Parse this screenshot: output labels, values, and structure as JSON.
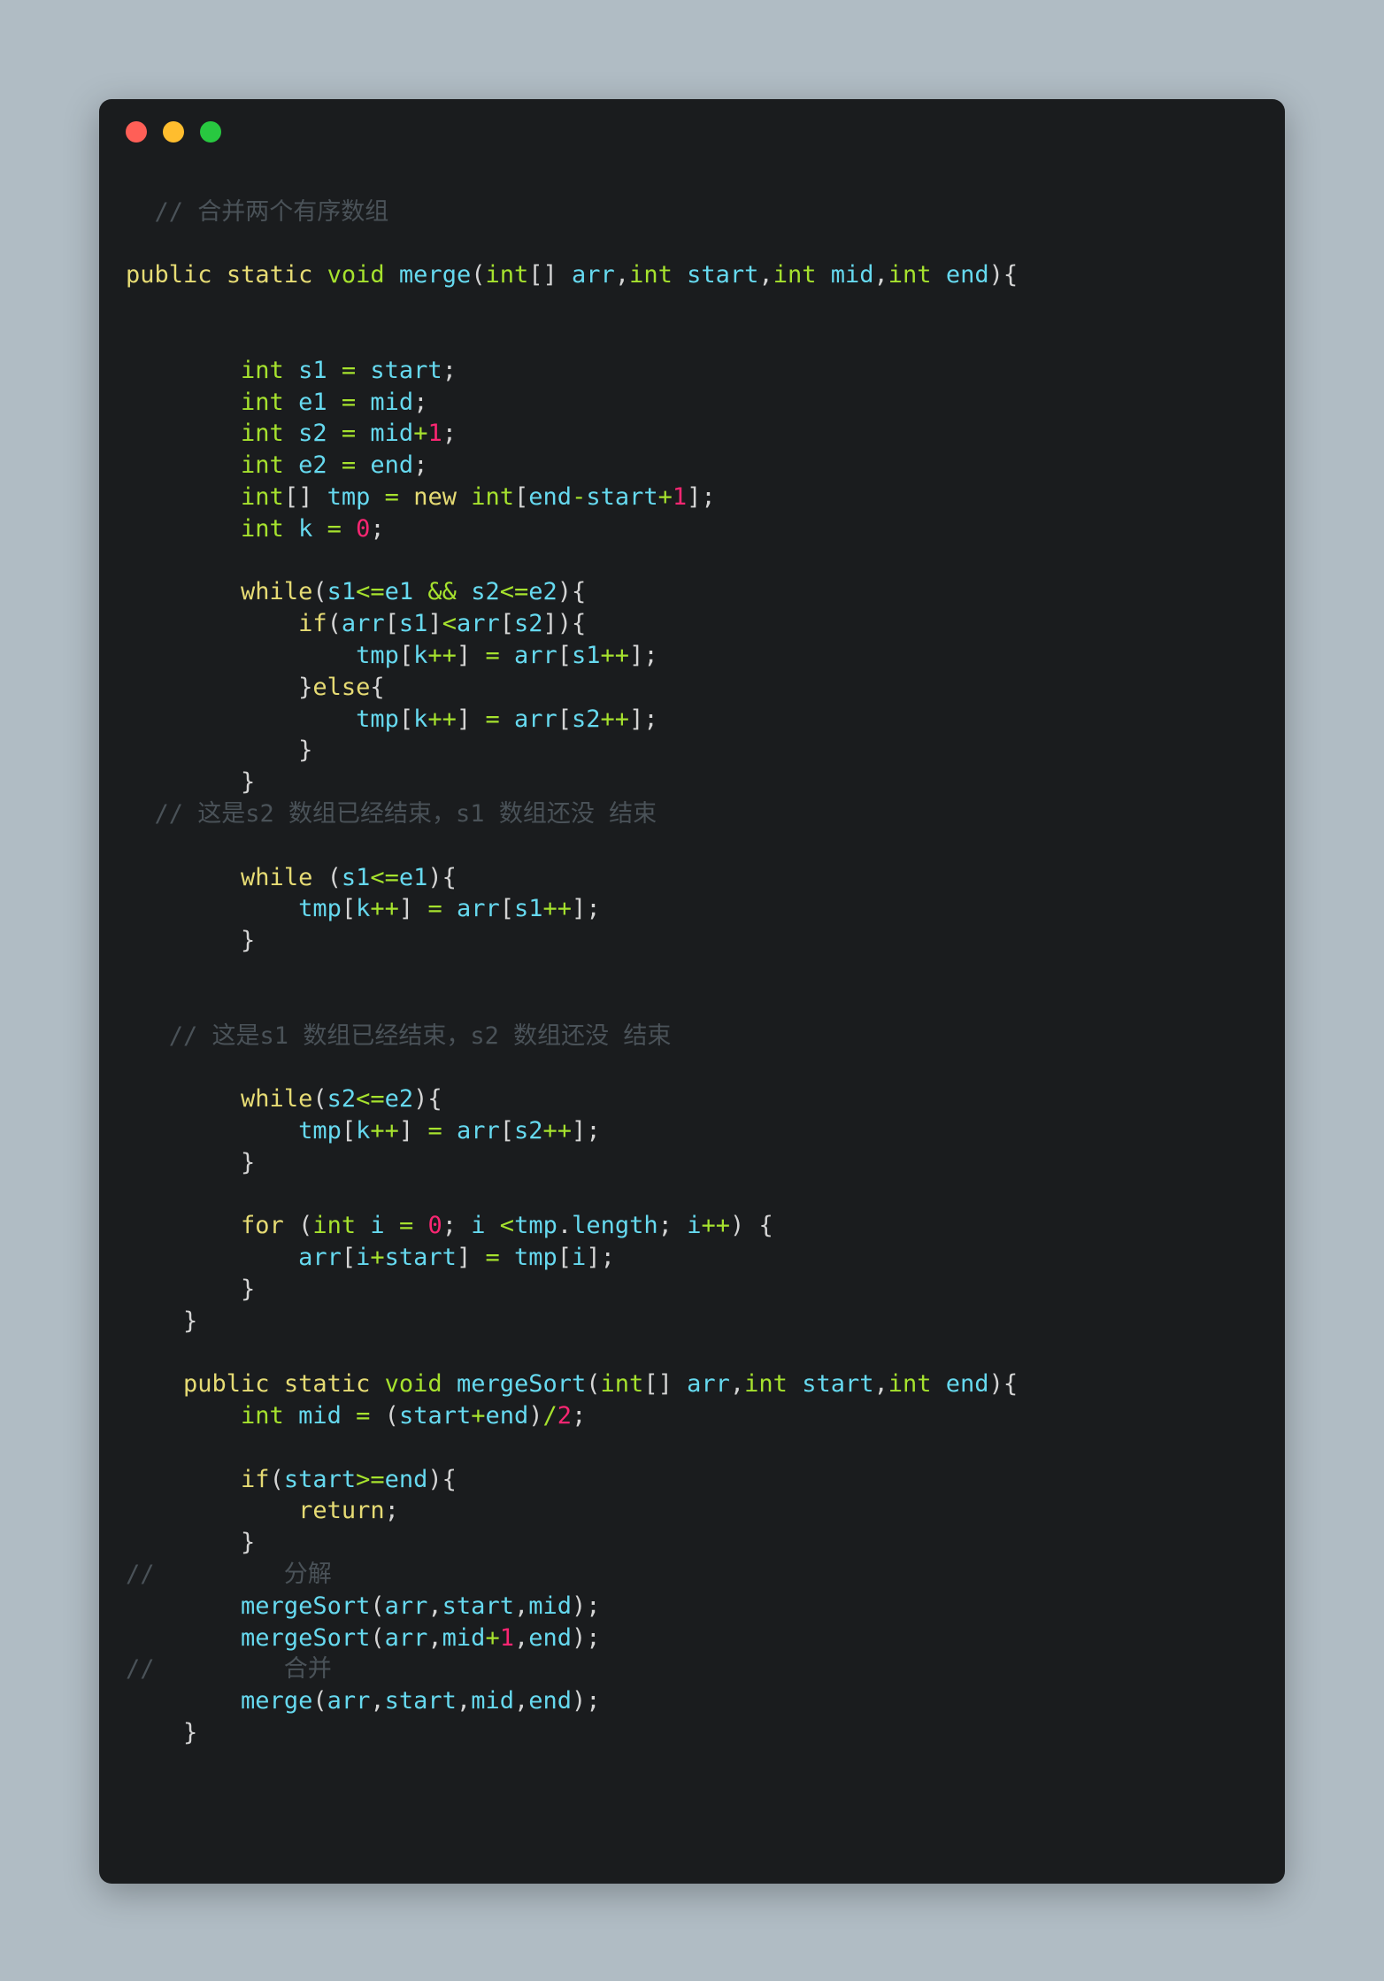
{
  "window": {
    "background_color": "#1a1c1e",
    "page_background_color": "#b0bcc4",
    "traffic_lights": [
      {
        "name": "close",
        "color": "#ff5f57"
      },
      {
        "name": "minimize",
        "color": "#ffbd2e"
      },
      {
        "name": "maximize",
        "color": "#28c840"
      }
    ]
  },
  "theme": {
    "keyword": "#e6db74",
    "type": "#a6e22e",
    "identifier": "#66d9ef",
    "number": "#f92672",
    "operator": "#a6e22e",
    "punctuation": "#d4d4d4",
    "comment": "#4a5258"
  },
  "code": {
    "language": "java",
    "lines": [
      "",
      "  // 合并两个有序数组",
      "",
      "public static void merge(int[] arr,int start,int mid,int end){",
      "",
      "",
      "        int s1 = start;",
      "        int e1 = mid;",
      "        int s2 = mid+1;",
      "        int e2 = end;",
      "        int[] tmp = new int[end-start+1];",
      "        int k = 0;",
      "",
      "        while(s1<=e1 && s2<=e2){",
      "            if(arr[s1]<arr[s2]){",
      "                tmp[k++] = arr[s1++];",
      "            }else{",
      "                tmp[k++] = arr[s2++];",
      "            }",
      "        }",
      "  // 这是s2 数组已经结束，s1 数组还没 结束",
      "",
      "        while (s1<=e1){",
      "            tmp[k++] = arr[s1++];",
      "        }",
      "",
      "",
      "   // 这是s1 数组已经结束，s2 数组还没 结束",
      "",
      "        while(s2<=e2){",
      "            tmp[k++] = arr[s2++];",
      "        }",
      "",
      "        for (int i = 0; i <tmp.length; i++) {",
      "            arr[i+start] = tmp[i];",
      "        }",
      "    }",
      "",
      "    public static void mergeSort(int[] arr,int start,int end){",
      "        int mid = (start+end)/2;",
      "",
      "        if(start>=end){",
      "            return;",
      "        }",
      "//         分解",
      "        mergeSort(arr,start,mid);",
      "        mergeSort(arr,mid+1,end);",
      "//         合并",
      "        merge(arr,start,mid,end);",
      "    }"
    ],
    "comments": [
      "// 合并两个有序数组",
      "// 这是s2 数组已经结束，s1 数组还没 结束",
      "// 这是s1 数组已经结束，s2 数组还没 结束",
      "//         分解",
      "//         合并"
    ],
    "functions": [
      "merge",
      "mergeSort"
    ]
  }
}
